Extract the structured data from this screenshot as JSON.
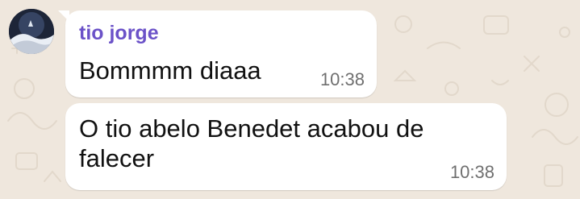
{
  "colors": {
    "wallpaper": "#efe7dd",
    "bubble": "#ffffff",
    "sender_name": "#6b52c8",
    "message_text": "#111111",
    "timestamp": "#6f6f6f"
  },
  "chat": {
    "messages": [
      {
        "sender": "tio jorge",
        "avatar_icon": "contact-avatar",
        "text": "Bommmm diaaa",
        "time": "10:38"
      },
      {
        "text": "O tio abelo Benedet acabou de falecer",
        "time": "10:38"
      }
    ]
  }
}
